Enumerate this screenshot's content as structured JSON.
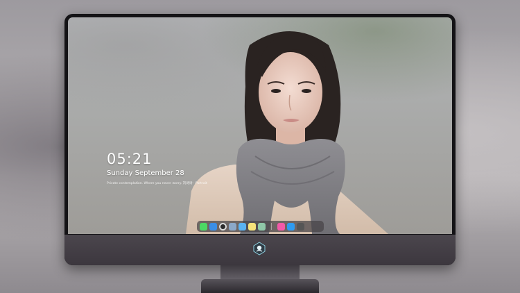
{
  "lock_screen": {
    "time": "05:21",
    "date": "Sunday September  28",
    "caption": "Private contemplation. Where you never worry. 刘诗诗 · Portrait"
  },
  "dock": {
    "apps": [
      {
        "name": "messages-icon",
        "color": "#4cd964"
      },
      {
        "name": "finder-icon",
        "color": "#3a8ee6"
      },
      {
        "name": "clock-icon",
        "color": "#2b2b2b"
      },
      {
        "name": "preview-icon",
        "color": "#8ba8c8"
      },
      {
        "name": "video-icon",
        "color": "#5ab2f0"
      },
      {
        "name": "notes-icon",
        "color": "#f6e27a"
      },
      {
        "name": "photos-icon",
        "color": "#8fc7a8"
      },
      {
        "name": "music-icon",
        "color": "#f25aa8"
      },
      {
        "name": "app-store-icon",
        "color": "#2e9bf0"
      },
      {
        "name": "camera-icon",
        "color": "#555555"
      }
    ]
  },
  "colors": {
    "bezel": "#141316",
    "chin": "#423d44",
    "dock": "#464246"
  }
}
